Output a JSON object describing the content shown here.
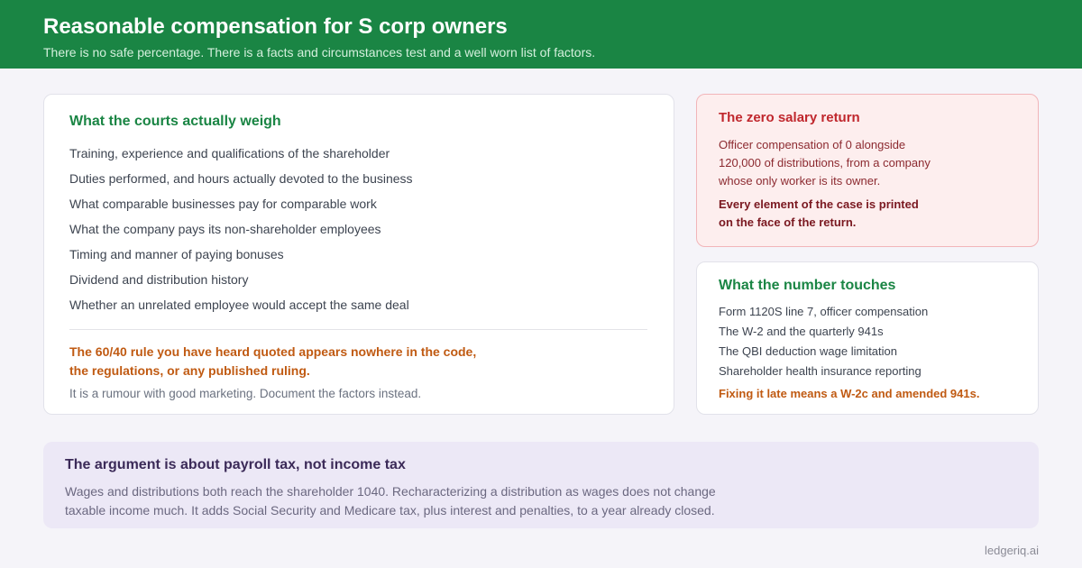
{
  "header": {
    "title": "Reasonable compensation for S corp owners",
    "subtitle": "There is no safe percentage. There is a facts and circumstances test and a well worn list of factors."
  },
  "courts": {
    "title": "What the courts actually weigh",
    "factors": [
      "Training, experience and qualifications of the shareholder",
      "Duties performed, and hours actually devoted to the business",
      "What comparable businesses pay for comparable work",
      "What the company pays its non-shareholder employees",
      "Timing and manner of paying bonuses",
      "Dividend and distribution history",
      "Whether an unrelated employee would accept the same deal"
    ],
    "myth": "The 60/40 rule you have heard quoted appears nowhere in the code, the regulations, or any published ruling.",
    "myth_note": "It is a rumour with good marketing. Document the factors instead."
  },
  "zero_salary": {
    "title": "The zero salary return",
    "body": "Officer compensation of 0 alongside 120,000 of distributions, from a company whose only worker is its owner.",
    "emphasis": "Every element of the case is printed on the face of the return."
  },
  "touches": {
    "title": "What the number touches",
    "items": [
      "Form 1120S line 7, officer compensation",
      "The W-2 and the quarterly 941s",
      "The QBI deduction wage limitation",
      "Shareholder health insurance reporting"
    ],
    "note": "Fixing it late means a W-2c and amended 941s."
  },
  "argument": {
    "title": "The argument is about payroll tax, not income tax",
    "body": "Wages and distributions both reach the shareholder 1040. Recharacterizing a distribution as wages does not change taxable income much. It adds Social Security and Medicare tax, plus interest and penalties, to a year already closed."
  },
  "brand": "ledgeriq.ai",
  "colors": {
    "header_green": "#1a8544",
    "alert_red": "#c0272d",
    "warning_orange": "#c05a12",
    "callout_purple": "#ece8f6"
  }
}
